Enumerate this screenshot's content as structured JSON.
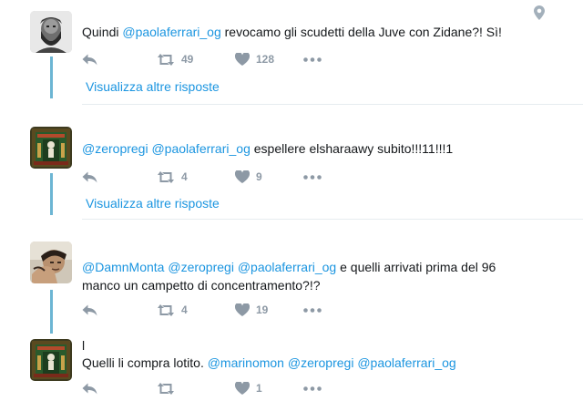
{
  "thread": {
    "tweets": [
      {
        "header": "",
        "text_parts": [
          "Quindi ",
          "@paolaferrari_og",
          " revocamo gli scudetti della Juve con Zidane?! Sì!"
        ],
        "reply_icon": "reply-icon",
        "retweets": "49",
        "likes": "128"
      },
      {
        "header": "",
        "text_parts": [
          "@zeropregi",
          " ",
          "@paolaferrari_og",
          " espellere elsharaawy subito!!!11!!!1"
        ],
        "retweets": "4",
        "likes": "9"
      },
      {
        "header": "",
        "text_line1": [
          "@DamnMonta",
          " ",
          "@zeropregi",
          " ",
          "@paolaferrari_og",
          " e quelli arrivati prima del 96"
        ],
        "text_line2": "manco un campetto di concentramento?!?",
        "retweets": "4",
        "likes": "19"
      },
      {
        "header": "l",
        "text_parts": [
          "Quelli li compra lotito. ",
          "@marinomon",
          " ",
          "@zeropregi",
          " ",
          "@paolaferrari_og"
        ],
        "retweets": "",
        "likes": "1"
      }
    ],
    "show_more_label": "Visualizza altre risposte"
  },
  "colors": {
    "mention": "#1b95e0",
    "thread_line": "#6cb5d3",
    "icon": "#8d99a5"
  },
  "icons": [
    "reply-icon",
    "retweet-icon",
    "like-icon",
    "more-icon",
    "location-pin-icon"
  ]
}
